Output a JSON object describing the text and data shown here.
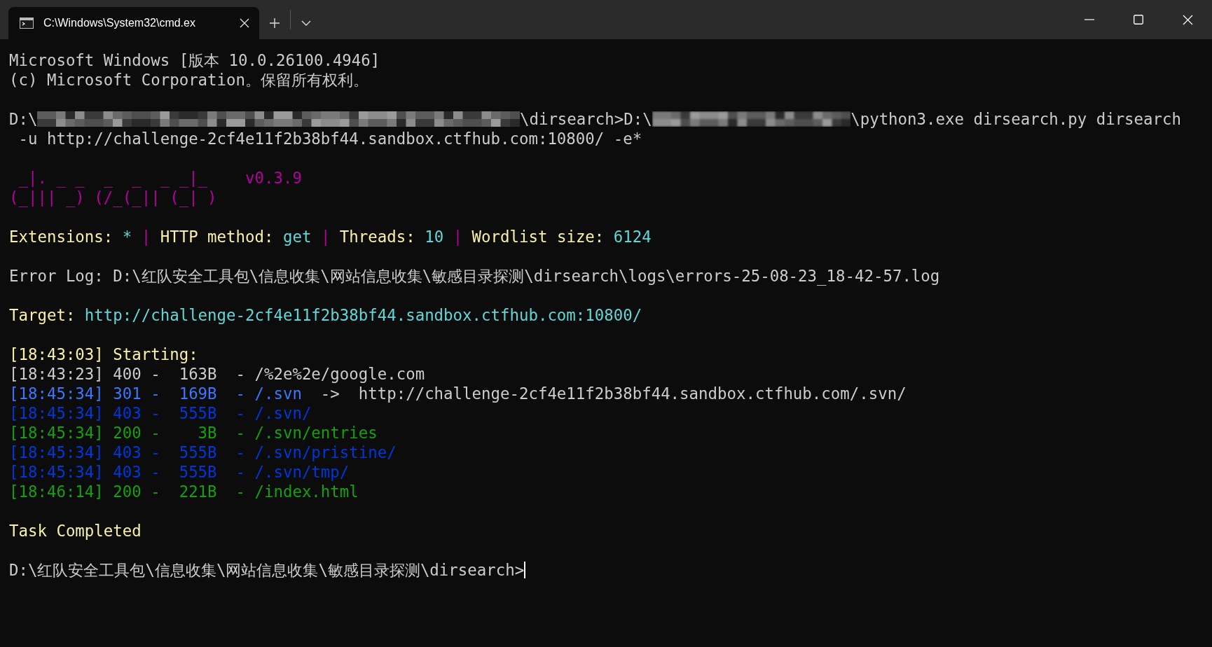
{
  "tabs": [
    {
      "title": "C:\\Windows\\System32\\cmd.ex",
      "selected": true
    }
  ],
  "lines": [
    {
      "kind": "text",
      "segments": [
        {
          "kind": "text",
          "text": "Microsoft Windows [版本 10.0.26100.4946]",
          "color": "#cccccc"
        }
      ]
    },
    {
      "kind": "text",
      "segments": [
        {
          "kind": "text",
          "text": "(c) Microsoft Corporation。保留所有权利。",
          "color": "#cccccc"
        }
      ]
    },
    {
      "kind": "blank"
    },
    {
      "kind": "text",
      "segments": [
        {
          "kind": "text",
          "text": "D:\\",
          "color": "#cccccc"
        },
        {
          "kind": "mosaic"
        },
        {
          "kind": "text",
          "text": "\\dirsearch>D:\\",
          "color": "#cccccc"
        },
        {
          "kind": "blur"
        },
        {
          "kind": "text",
          "text": "\\python3.exe dirsearch.py dirsearch",
          "color": "#cccccc"
        }
      ]
    },
    {
      "kind": "text",
      "segments": [
        {
          "kind": "text",
          "text": " -u http://challenge-2cf4e11f2b38bf44.sandbox.ctfhub.com:10800/ -e*",
          "color": "#cccccc"
        }
      ]
    },
    {
      "kind": "blank"
    },
    {
      "kind": "text",
      "segments": [
        {
          "kind": "text",
          "text": " _|. _ _  _  _  _ _|_    v0.3.9",
          "color": "#b4009e"
        }
      ]
    },
    {
      "kind": "text",
      "segments": [
        {
          "kind": "text",
          "text": "(_||| _) (/_(_|| (_| )",
          "color": "#b4009e"
        }
      ]
    },
    {
      "kind": "blank"
    },
    {
      "kind": "text",
      "segments": [
        {
          "kind": "text",
          "text": "Extensions: ",
          "color": "#f9f1a5"
        },
        {
          "kind": "text",
          "text": "*",
          "color": "#61d6d6"
        },
        {
          "kind": "text",
          "text": " | ",
          "color": "#b4009e"
        },
        {
          "kind": "text",
          "text": "HTTP method: ",
          "color": "#f9f1a5"
        },
        {
          "kind": "text",
          "text": "get",
          "color": "#61d6d6"
        },
        {
          "kind": "text",
          "text": " | ",
          "color": "#b4009e"
        },
        {
          "kind": "text",
          "text": "Threads: ",
          "color": "#f9f1a5"
        },
        {
          "kind": "text",
          "text": "10",
          "color": "#61d6d6"
        },
        {
          "kind": "text",
          "text": " | ",
          "color": "#b4009e"
        },
        {
          "kind": "text",
          "text": "Wordlist size: ",
          "color": "#f9f1a5"
        },
        {
          "kind": "text",
          "text": "6124",
          "color": "#61d6d6"
        }
      ]
    },
    {
      "kind": "blank"
    },
    {
      "kind": "text",
      "segments": [
        {
          "kind": "text",
          "text": "Error Log: D:\\红队安全工具包\\信息收集\\网站信息收集\\敏感目录探测\\dirsearch\\logs\\errors-25-08-23_18-42-57.log",
          "color": "#cccccc"
        }
      ]
    },
    {
      "kind": "blank"
    },
    {
      "kind": "text",
      "segments": [
        {
          "kind": "text",
          "text": "Target: ",
          "color": "#f9f1a5"
        },
        {
          "kind": "text",
          "text": "http://challenge-2cf4e11f2b38bf44.sandbox.ctfhub.com:10800/",
          "color": "#61d6d6"
        }
      ]
    },
    {
      "kind": "blank"
    },
    {
      "kind": "text",
      "segments": [
        {
          "kind": "text",
          "text": "[18:43:03] Starting:",
          "color": "#f9f1a5"
        }
      ]
    },
    {
      "kind": "text",
      "segments": [
        {
          "kind": "text",
          "text": "[18:43:23] 400 -  163B  - /%2e%2e/google.com",
          "color": "#cccccc"
        }
      ]
    },
    {
      "kind": "text",
      "segments": [
        {
          "kind": "text",
          "text": "[18:45:34] 301 -  169B  - /.svn",
          "color": "#3b78ff"
        },
        {
          "kind": "text",
          "text": "  ->  http://challenge-2cf4e11f2b38bf44.sandbox.ctfhub.com/.svn/",
          "color": "#cccccc"
        }
      ]
    },
    {
      "kind": "text",
      "segments": [
        {
          "kind": "text",
          "text": "[18:45:34] 403 -  555B  - /.svn/",
          "color": "#0037da"
        }
      ]
    },
    {
      "kind": "text",
      "segments": [
        {
          "kind": "text",
          "text": "[18:45:34] 200 -    3B  - /.svn/entries",
          "color": "#13a10e"
        }
      ]
    },
    {
      "kind": "text",
      "segments": [
        {
          "kind": "text",
          "text": "[18:45:34] 403 -  555B  - /.svn/pristine/",
          "color": "#0037da"
        }
      ]
    },
    {
      "kind": "text",
      "segments": [
        {
          "kind": "text",
          "text": "[18:45:34] 403 -  555B  - /.svn/tmp/",
          "color": "#0037da"
        }
      ]
    },
    {
      "kind": "text",
      "segments": [
        {
          "kind": "text",
          "text": "[18:46:14] 200 -  221B  - /index.html",
          "color": "#13a10e"
        }
      ]
    },
    {
      "kind": "blank"
    },
    {
      "kind": "text",
      "segments": [
        {
          "kind": "text",
          "text": "Task Completed",
          "color": "#f9f1a5"
        }
      ]
    },
    {
      "kind": "blank"
    },
    {
      "kind": "text",
      "segments": [
        {
          "kind": "text",
          "text": "D:\\红队安全工具包\\信息收集\\网站信息收集\\敏感目录探测\\dirsearch>",
          "color": "#cccccc"
        },
        {
          "kind": "cursor"
        }
      ]
    }
  ]
}
